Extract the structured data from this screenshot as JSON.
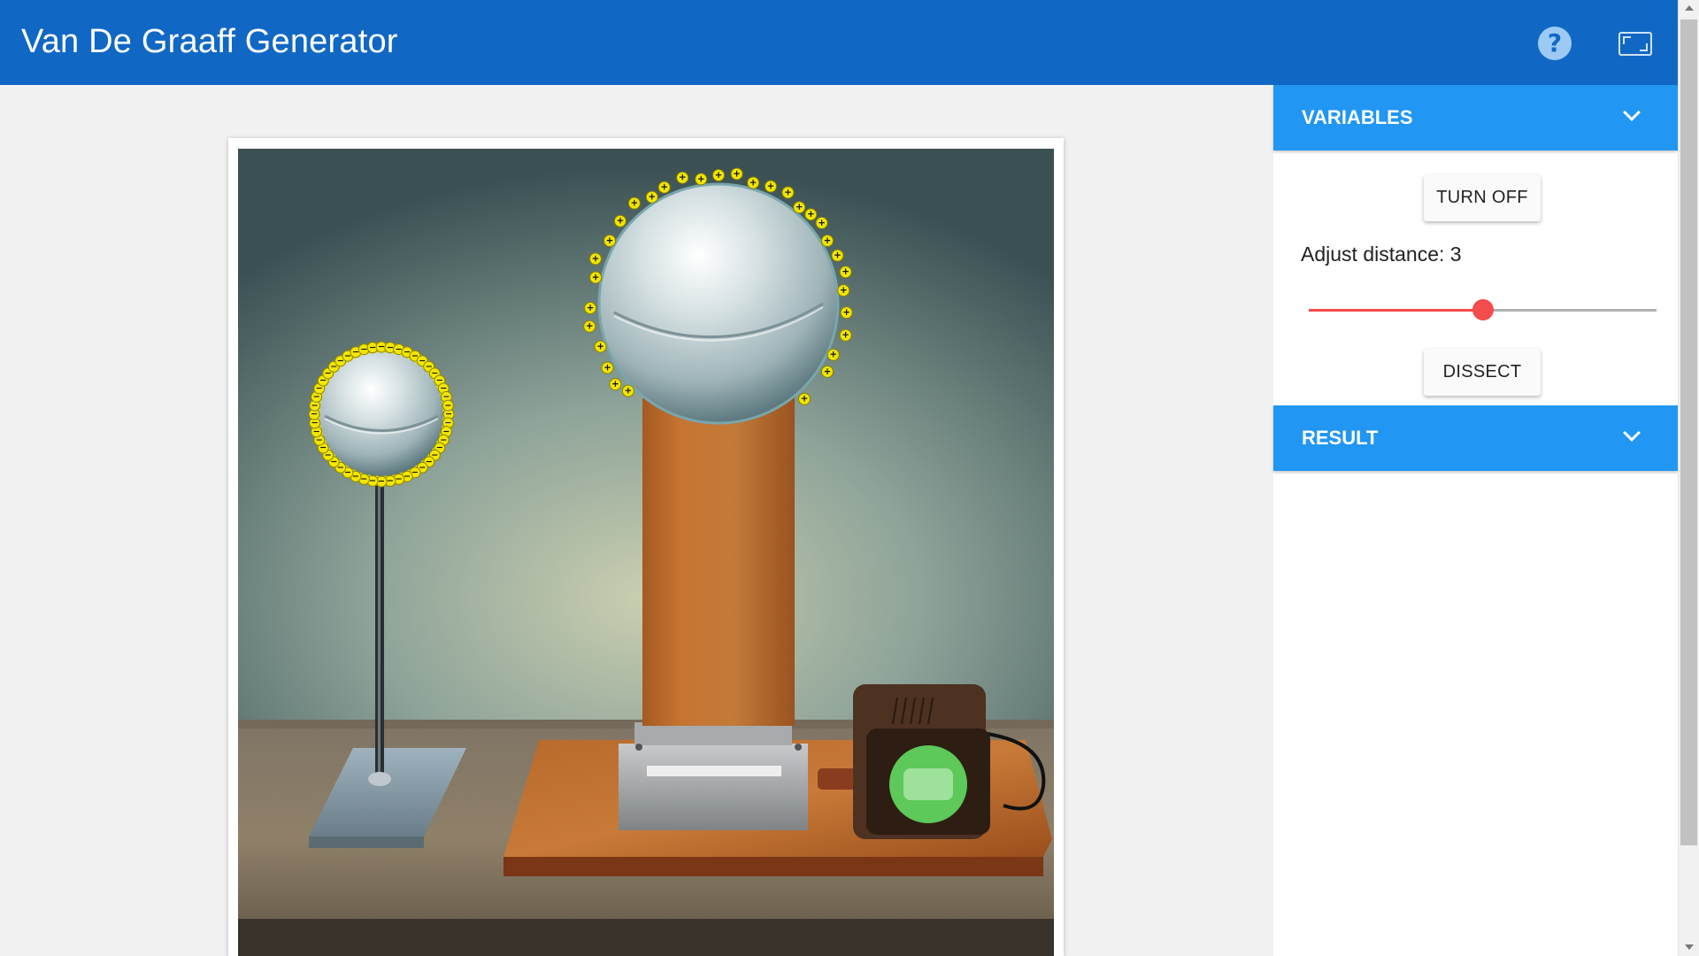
{
  "header": {
    "title": "Van De Graaff Generator",
    "help_icon": "question-mark-icon",
    "fullscreen_icon": "fullscreen-icon",
    "help_glyph": "?"
  },
  "colors": {
    "header_bg": "#1168c4",
    "panel_header_bg": "#2196f3",
    "slider_accent": "#f44b4b",
    "charge_yellow": "#f2e600"
  },
  "panel": {
    "variables": {
      "label": "VARIABLES",
      "turn_off_label": "TURN OFF",
      "slider_label": "Adjust distance: 3",
      "slider_value_fraction": 0.5,
      "dissect_label": "DISSECT"
    },
    "result": {
      "label": "RESULT"
    }
  },
  "simulation": {
    "small_sphere_charge": "−",
    "large_sphere_charge": "+",
    "power_indicator": "green-light-icon"
  }
}
